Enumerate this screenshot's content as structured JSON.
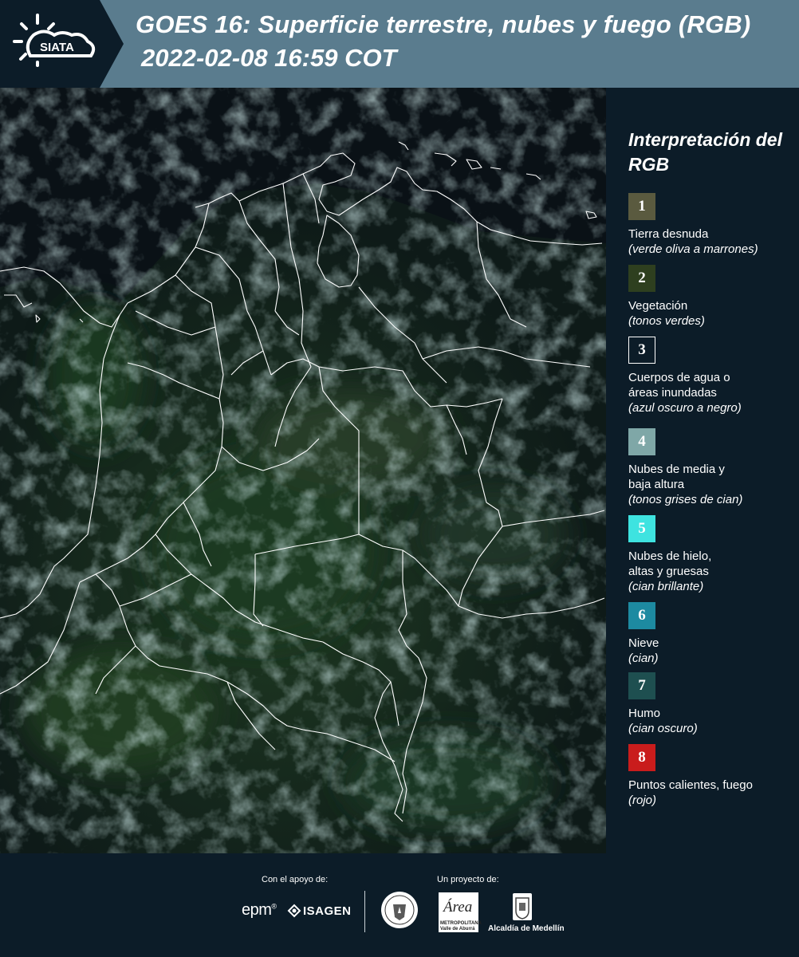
{
  "header": {
    "logo_text": "SIATA",
    "title": "GOES 16: Superficie terrestre, nubes y fuego (RGB)",
    "subtitle": "2022-02-08 16:59 COT"
  },
  "legend": {
    "title": "Interpretación del RGB",
    "items": [
      {
        "number": "1",
        "label": "Tierra desnuda",
        "desc": "(verde oliva a marrones)",
        "color": "#5a5a3f"
      },
      {
        "number": "2",
        "label": "Vegetación",
        "desc": "(tonos verdes)",
        "color": "#2e3f1f"
      },
      {
        "number": "3",
        "label": "Cuerpos de agua o\náreas inundadas",
        "desc": "(azul oscuro a negro)",
        "color": "#0c1c28"
      },
      {
        "number": "4",
        "label": "Nubes de media y\nbaja altura",
        "desc": "(tonos grises de cian)",
        "color": "#7fa7a7"
      },
      {
        "number": "5",
        "label": "Nubes de hielo,\naltas y gruesas",
        "desc": "(cian brillante)",
        "color": "#3ee3e0"
      },
      {
        "number": "6",
        "label": "Nieve",
        "desc": "(cian)",
        "color": "#1d8aa1"
      },
      {
        "number": "7",
        "label": "Humo",
        "desc": "(cian oscuro)",
        "color": "#1e4f50"
      },
      {
        "number": "8",
        "label": "Puntos calientes, fuego",
        "desc": "(rojo)",
        "color": "#c91c1c"
      }
    ]
  },
  "footer": {
    "support_caption": "Con el apoyo de:",
    "project_caption": "Un proyecto de:",
    "epm": "epm",
    "isagen": "ISAGEN",
    "area_script": "Área",
    "area_text": "METROPOLITANA\nValle de Aburrá",
    "alcaldia": "Alcaldía de Medellín"
  },
  "colors": {
    "header_bg": "#5a7c8e",
    "logo_bg": "#0c1c28",
    "page_bg": "#0c1c28",
    "border_lines": "#ffffff"
  },
  "icons": [
    "siata-logo",
    "isagen-icon",
    "seal-icon",
    "alcaldia-shield-icon"
  ]
}
